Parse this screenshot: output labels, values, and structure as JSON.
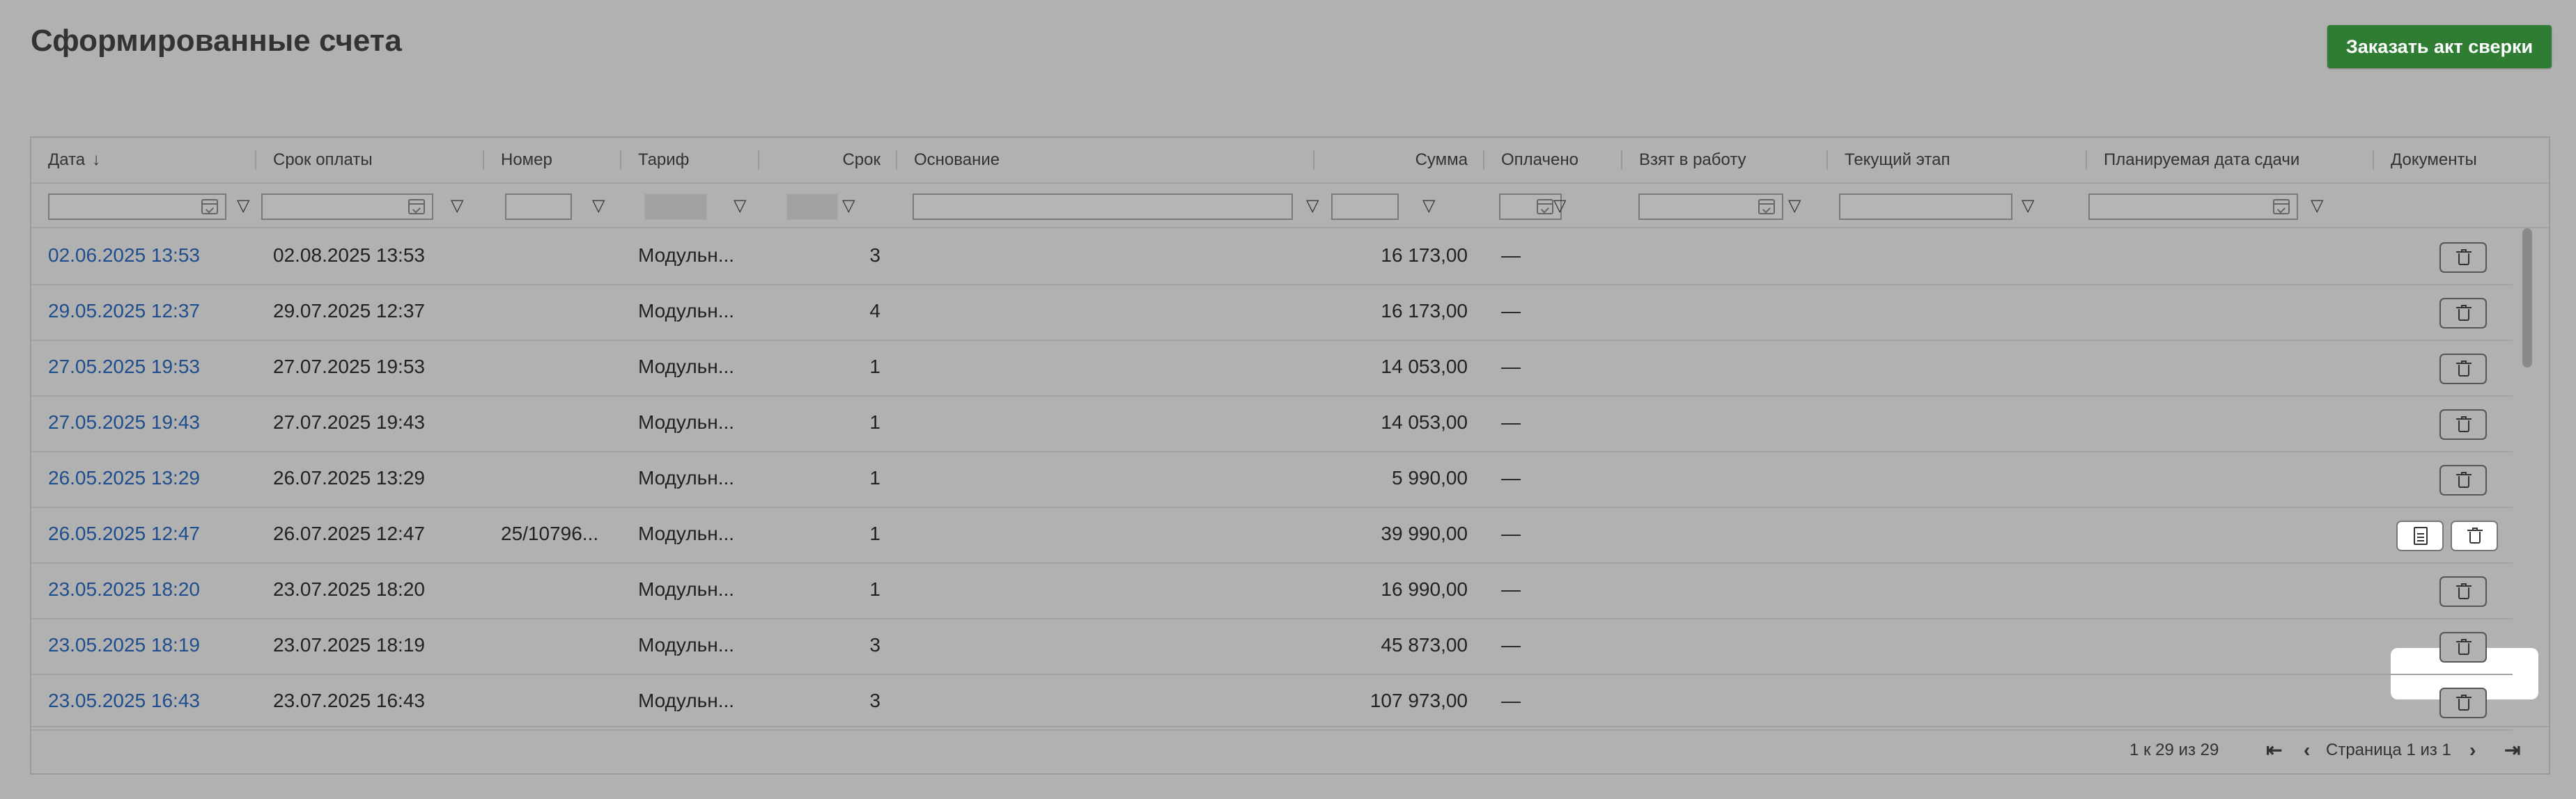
{
  "page": {
    "title": "Сформированные счета",
    "order_button": "Заказать акт сверки"
  },
  "table": {
    "columns": [
      {
        "key": "date",
        "label": "Дата",
        "sort": "↓"
      },
      {
        "key": "due",
        "label": "Срок оплаты"
      },
      {
        "key": "number",
        "label": "Номер"
      },
      {
        "key": "tariff",
        "label": "Тариф"
      },
      {
        "key": "term",
        "label": "Срок"
      },
      {
        "key": "basis",
        "label": "Основание"
      },
      {
        "key": "sum",
        "label": "Сумма"
      },
      {
        "key": "paid",
        "label": "Оплачено"
      },
      {
        "key": "taken",
        "label": "Взят в работу"
      },
      {
        "key": "stage",
        "label": "Текущий этап"
      },
      {
        "key": "planned",
        "label": "Планируемая дата сдачи"
      },
      {
        "key": "docs",
        "label": "Документы"
      }
    ],
    "rows": [
      {
        "date": "02.06.2025 13:53",
        "due": "02.08.2025 13:53",
        "number": "",
        "tariff": "Модульн...",
        "term": "3",
        "sum": "16 173,00",
        "paid": "—",
        "docs": [
          "delete"
        ]
      },
      {
        "date": "29.05.2025 12:37",
        "due": "29.07.2025 12:37",
        "number": "",
        "tariff": "Модульн...",
        "term": "4",
        "sum": "16 173,00",
        "paid": "—",
        "docs": [
          "delete"
        ]
      },
      {
        "date": "27.05.2025 19:53",
        "due": "27.07.2025 19:53",
        "number": "",
        "tariff": "Модульн...",
        "term": "1",
        "sum": "14 053,00",
        "paid": "—",
        "docs": [
          "delete"
        ]
      },
      {
        "date": "27.05.2025 19:43",
        "due": "27.07.2025 19:43",
        "number": "",
        "tariff": "Модульн...",
        "term": "1",
        "sum": "14 053,00",
        "paid": "—",
        "docs": [
          "delete"
        ]
      },
      {
        "date": "26.05.2025 13:29",
        "due": "26.07.2025 13:29",
        "number": "",
        "tariff": "Модульн...",
        "term": "1",
        "sum": "5 990,00",
        "paid": "—",
        "docs": [
          "delete"
        ]
      },
      {
        "date": "26.05.2025 12:47",
        "due": "26.07.2025 12:47",
        "number": "25/10796...",
        "tariff": "Модульн...",
        "term": "1",
        "sum": "39 990,00",
        "paid": "—",
        "docs": [
          "document",
          "delete"
        ]
      },
      {
        "date": "23.05.2025 18:20",
        "due": "23.07.2025 18:20",
        "number": "",
        "tariff": "Модульн...",
        "term": "1",
        "sum": "16 990,00",
        "paid": "—",
        "docs": [
          "delete"
        ]
      },
      {
        "date": "23.05.2025 18:19",
        "due": "23.07.2025 18:19",
        "number": "",
        "tariff": "Модульн...",
        "term": "3",
        "sum": "45 873,00",
        "paid": "—",
        "docs": [
          "delete"
        ]
      },
      {
        "date": "23.05.2025 16:43",
        "due": "23.07.2025 16:43",
        "number": "",
        "tariff": "Модульн...",
        "term": "3",
        "sum": "107 973,00",
        "paid": "—",
        "docs": [
          "delete"
        ]
      }
    ]
  },
  "footer": {
    "range_text": "1 к 29 из 29",
    "page_text": "Страница 1 из 1",
    "first_icon": "⇤",
    "prev_icon": "‹",
    "next_icon": "›",
    "last_icon": "⇥"
  },
  "icons": {
    "filter": "funnel-icon",
    "calendar": "calendar-icon",
    "delete": "trash-icon",
    "document": "file-icon"
  }
}
